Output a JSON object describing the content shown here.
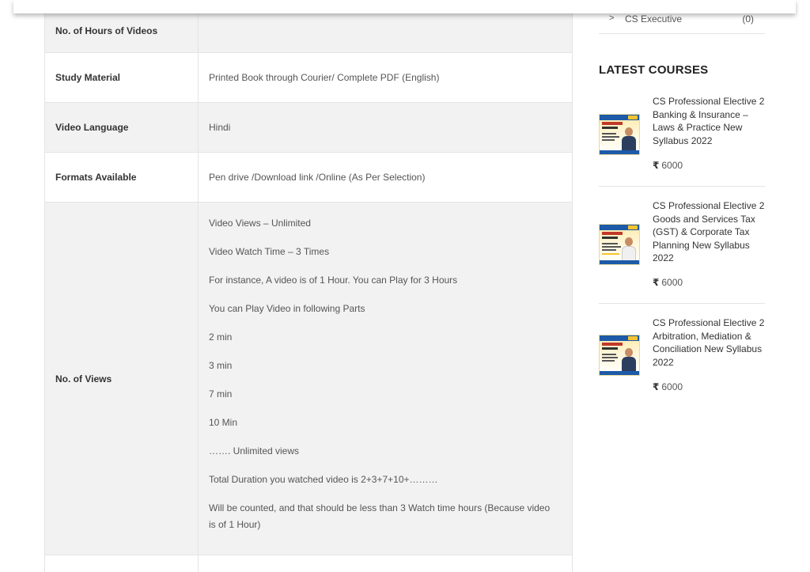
{
  "spec_table": {
    "rows": [
      {
        "label": "No. of Hours of Videos",
        "value": ""
      },
      {
        "label": "Study Material",
        "value": "Printed Book through Courier/ Complete PDF (English)"
      },
      {
        "label": "Video Language",
        "value": "Hindi"
      },
      {
        "label": "Formats Available",
        "value": "Pen drive /Download link /Online (As Per Selection)"
      }
    ],
    "views": {
      "label": "No. of Views",
      "lines": [
        "Video Views – Unlimited",
        "Video Watch Time – 3 Times",
        "For instance, A video is of 1 Hour. You can Play for 3 Hours",
        "You can Play Video in following Parts",
        "2 min",
        "3 min",
        "7 min",
        "10 Min",
        "……. Unlimited views",
        "Total Duration you watched video is 2+3+7+10+………",
        "Will be counted, and that should be less than 3 Watch time hours (Because video is of 1 Hour)"
      ]
    }
  },
  "sidebar": {
    "category": {
      "icon": "chevron-right-icon",
      "name": "CS Executive",
      "count": "(0)"
    },
    "latest_title": "LATEST COURSES",
    "currency_symbol": "₹",
    "courses": [
      {
        "title": "CS Professional Elective 2 Banking & Insurance – Laws & Practice New Syllabus 2022",
        "price": "6000"
      },
      {
        "title": "CS Professional Elective 2 Goods and Services Tax (GST) & Corporate Tax Planning New Syllabus 2022",
        "price": "6000"
      },
      {
        "title": "CS Professional Elective 2 Arbitration, Mediation & Conciliation New Syllabus 2022",
        "price": "6000"
      }
    ]
  }
}
